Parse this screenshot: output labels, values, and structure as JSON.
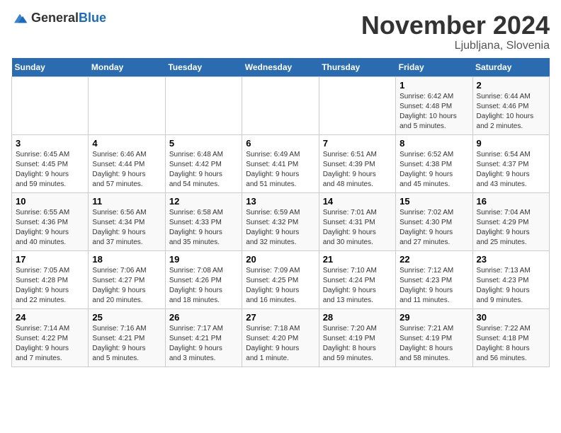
{
  "logo": {
    "general": "General",
    "blue": "Blue"
  },
  "title": "November 2024",
  "location": "Ljubljana, Slovenia",
  "weekdays": [
    "Sunday",
    "Monday",
    "Tuesday",
    "Wednesday",
    "Thursday",
    "Friday",
    "Saturday"
  ],
  "weeks": [
    [
      {
        "day": "",
        "info": ""
      },
      {
        "day": "",
        "info": ""
      },
      {
        "day": "",
        "info": ""
      },
      {
        "day": "",
        "info": ""
      },
      {
        "day": "",
        "info": ""
      },
      {
        "day": "1",
        "info": "Sunrise: 6:42 AM\nSunset: 4:48 PM\nDaylight: 10 hours\nand 5 minutes."
      },
      {
        "day": "2",
        "info": "Sunrise: 6:44 AM\nSunset: 4:46 PM\nDaylight: 10 hours\nand 2 minutes."
      }
    ],
    [
      {
        "day": "3",
        "info": "Sunrise: 6:45 AM\nSunset: 4:45 PM\nDaylight: 9 hours\nand 59 minutes."
      },
      {
        "day": "4",
        "info": "Sunrise: 6:46 AM\nSunset: 4:44 PM\nDaylight: 9 hours\nand 57 minutes."
      },
      {
        "day": "5",
        "info": "Sunrise: 6:48 AM\nSunset: 4:42 PM\nDaylight: 9 hours\nand 54 minutes."
      },
      {
        "day": "6",
        "info": "Sunrise: 6:49 AM\nSunset: 4:41 PM\nDaylight: 9 hours\nand 51 minutes."
      },
      {
        "day": "7",
        "info": "Sunrise: 6:51 AM\nSunset: 4:39 PM\nDaylight: 9 hours\nand 48 minutes."
      },
      {
        "day": "8",
        "info": "Sunrise: 6:52 AM\nSunset: 4:38 PM\nDaylight: 9 hours\nand 45 minutes."
      },
      {
        "day": "9",
        "info": "Sunrise: 6:54 AM\nSunset: 4:37 PM\nDaylight: 9 hours\nand 43 minutes."
      }
    ],
    [
      {
        "day": "10",
        "info": "Sunrise: 6:55 AM\nSunset: 4:36 PM\nDaylight: 9 hours\nand 40 minutes."
      },
      {
        "day": "11",
        "info": "Sunrise: 6:56 AM\nSunset: 4:34 PM\nDaylight: 9 hours\nand 37 minutes."
      },
      {
        "day": "12",
        "info": "Sunrise: 6:58 AM\nSunset: 4:33 PM\nDaylight: 9 hours\nand 35 minutes."
      },
      {
        "day": "13",
        "info": "Sunrise: 6:59 AM\nSunset: 4:32 PM\nDaylight: 9 hours\nand 32 minutes."
      },
      {
        "day": "14",
        "info": "Sunrise: 7:01 AM\nSunset: 4:31 PM\nDaylight: 9 hours\nand 30 minutes."
      },
      {
        "day": "15",
        "info": "Sunrise: 7:02 AM\nSunset: 4:30 PM\nDaylight: 9 hours\nand 27 minutes."
      },
      {
        "day": "16",
        "info": "Sunrise: 7:04 AM\nSunset: 4:29 PM\nDaylight: 9 hours\nand 25 minutes."
      }
    ],
    [
      {
        "day": "17",
        "info": "Sunrise: 7:05 AM\nSunset: 4:28 PM\nDaylight: 9 hours\nand 22 minutes."
      },
      {
        "day": "18",
        "info": "Sunrise: 7:06 AM\nSunset: 4:27 PM\nDaylight: 9 hours\nand 20 minutes."
      },
      {
        "day": "19",
        "info": "Sunrise: 7:08 AM\nSunset: 4:26 PM\nDaylight: 9 hours\nand 18 minutes."
      },
      {
        "day": "20",
        "info": "Sunrise: 7:09 AM\nSunset: 4:25 PM\nDaylight: 9 hours\nand 16 minutes."
      },
      {
        "day": "21",
        "info": "Sunrise: 7:10 AM\nSunset: 4:24 PM\nDaylight: 9 hours\nand 13 minutes."
      },
      {
        "day": "22",
        "info": "Sunrise: 7:12 AM\nSunset: 4:23 PM\nDaylight: 9 hours\nand 11 minutes."
      },
      {
        "day": "23",
        "info": "Sunrise: 7:13 AM\nSunset: 4:23 PM\nDaylight: 9 hours\nand 9 minutes."
      }
    ],
    [
      {
        "day": "24",
        "info": "Sunrise: 7:14 AM\nSunset: 4:22 PM\nDaylight: 9 hours\nand 7 minutes."
      },
      {
        "day": "25",
        "info": "Sunrise: 7:16 AM\nSunset: 4:21 PM\nDaylight: 9 hours\nand 5 minutes."
      },
      {
        "day": "26",
        "info": "Sunrise: 7:17 AM\nSunset: 4:21 PM\nDaylight: 9 hours\nand 3 minutes."
      },
      {
        "day": "27",
        "info": "Sunrise: 7:18 AM\nSunset: 4:20 PM\nDaylight: 9 hours\nand 1 minute."
      },
      {
        "day": "28",
        "info": "Sunrise: 7:20 AM\nSunset: 4:19 PM\nDaylight: 8 hours\nand 59 minutes."
      },
      {
        "day": "29",
        "info": "Sunrise: 7:21 AM\nSunset: 4:19 PM\nDaylight: 8 hours\nand 58 minutes."
      },
      {
        "day": "30",
        "info": "Sunrise: 7:22 AM\nSunset: 4:18 PM\nDaylight: 8 hours\nand 56 minutes."
      }
    ]
  ]
}
